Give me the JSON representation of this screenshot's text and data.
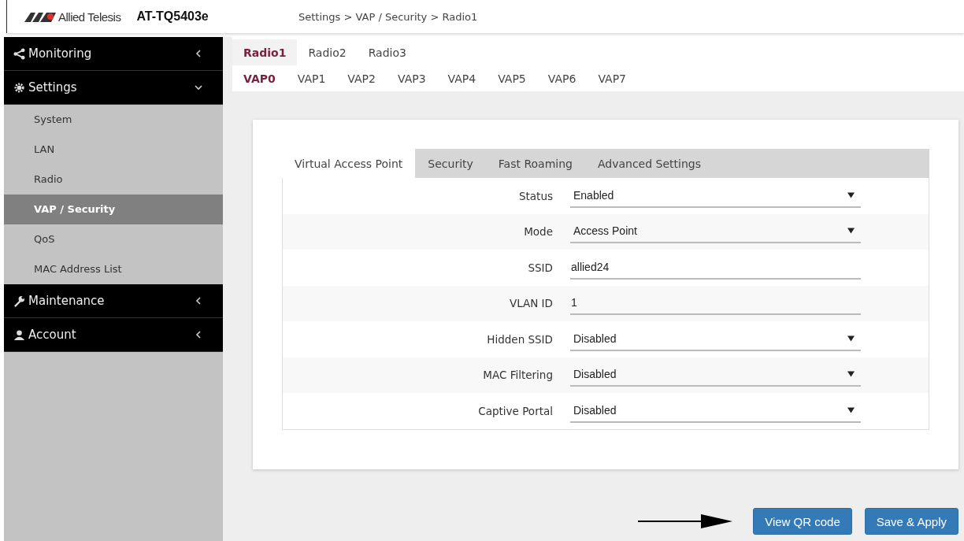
{
  "header": {
    "brand": "Allied Telesis",
    "model": "AT-TQ5403e",
    "breadcrumb": "Settings > VAP / Security > Radio1"
  },
  "sidebar": {
    "items": [
      {
        "label": "Monitoring",
        "expanded": false
      },
      {
        "label": "Settings",
        "expanded": true,
        "children": [
          {
            "label": "System",
            "selected": false
          },
          {
            "label": "LAN",
            "selected": false
          },
          {
            "label": "Radio",
            "selected": false
          },
          {
            "label": "VAP / Security",
            "selected": true
          },
          {
            "label": "QoS",
            "selected": false
          },
          {
            "label": "MAC Address List",
            "selected": false
          }
        ]
      },
      {
        "label": "Maintenance",
        "expanded": false
      },
      {
        "label": "Account",
        "expanded": false
      }
    ]
  },
  "radio_tabs": [
    {
      "label": "Radio1",
      "selected": true
    },
    {
      "label": "Radio2",
      "selected": false
    },
    {
      "label": "Radio3",
      "selected": false
    }
  ],
  "vap_tabs": [
    {
      "label": "VAP0",
      "selected": true
    },
    {
      "label": "VAP1",
      "selected": false
    },
    {
      "label": "VAP2",
      "selected": false
    },
    {
      "label": "VAP3",
      "selected": false
    },
    {
      "label": "VAP4",
      "selected": false
    },
    {
      "label": "VAP5",
      "selected": false
    },
    {
      "label": "VAP6",
      "selected": false
    },
    {
      "label": "VAP7",
      "selected": false
    }
  ],
  "form_tabs": [
    {
      "label": "Virtual Access Point",
      "selected": true
    },
    {
      "label": "Security",
      "selected": false
    },
    {
      "label": "Fast Roaming",
      "selected": false
    },
    {
      "label": "Advanced Settings",
      "selected": false
    }
  ],
  "fields": [
    {
      "label": "Status",
      "kind": "select",
      "value": "Enabled"
    },
    {
      "label": "Mode",
      "kind": "select",
      "value": "Access Point"
    },
    {
      "label": "SSID",
      "kind": "text",
      "value": "allied24"
    },
    {
      "label": "VLAN ID",
      "kind": "text",
      "value": "1"
    },
    {
      "label": "Hidden SSID",
      "kind": "select",
      "value": "Disabled"
    },
    {
      "label": "MAC Filtering",
      "kind": "select",
      "value": "Disabled"
    },
    {
      "label": "Captive Portal",
      "kind": "select",
      "value": "Disabled"
    }
  ],
  "buttons": [
    "View QR code",
    "Save & Apply"
  ]
}
